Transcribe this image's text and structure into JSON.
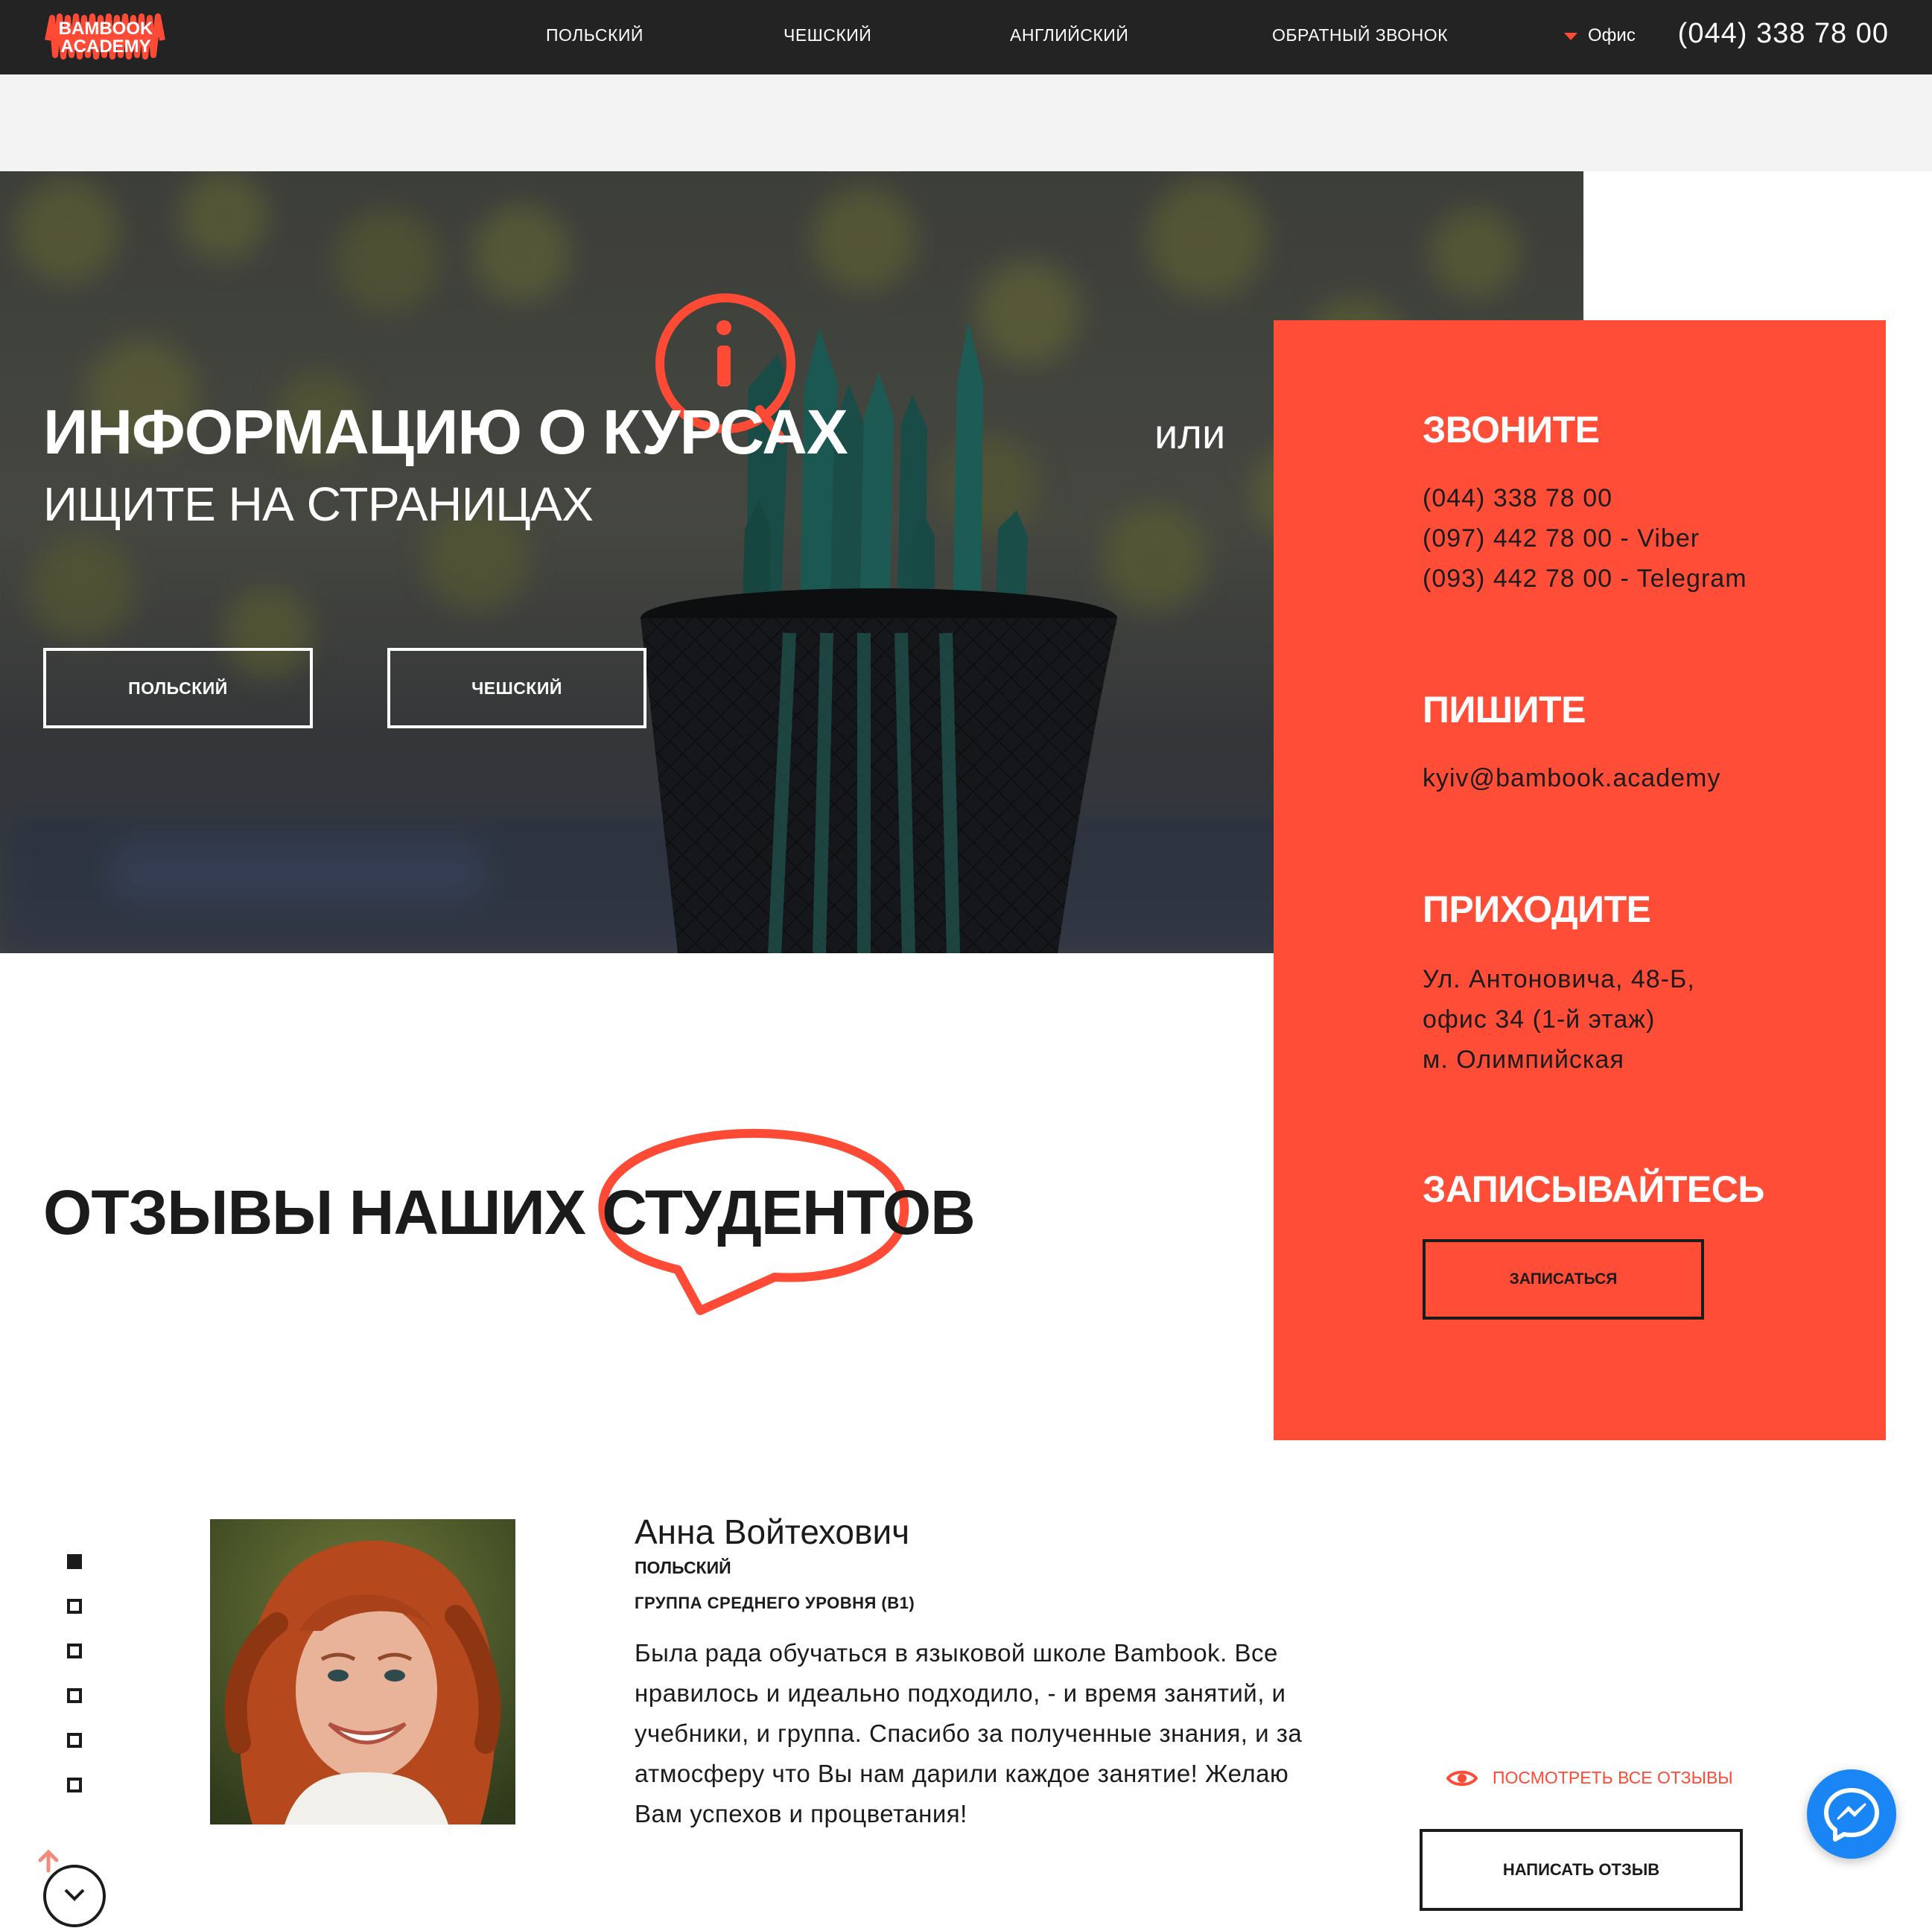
{
  "header": {
    "logo_line1": "BAMBOOK",
    "logo_line2": "ACADEMY",
    "nav": [
      "ПОЛЬСКИЙ",
      "ЧЕШСКИЙ",
      "АНГЛИЙСКИЙ",
      "ОБРАТНЫЙ ЗВОНОК"
    ],
    "office_label": "Офис",
    "phone": "(044) 338 78 00"
  },
  "hero": {
    "title": "ИНФОРМАЦИЮ О КУРСАХ",
    "subtitle": "ИЩИТЕ НА СТРАНИЦАХ",
    "or": "или",
    "buttons": [
      "ПОЛЬСКИЙ",
      "ЧЕШСКИЙ"
    ],
    "icon": "info-icon"
  },
  "contact": {
    "call_heading": "ЗВОНИТЕ",
    "phones": [
      "(044) 338 78 00",
      "(097) 442 78 00 - Viber",
      "(093) 442 78 00 - Telegram"
    ],
    "write_heading": "ПИШИТЕ",
    "email": "kyiv@bambook.academy",
    "visit_heading": "ПРИХОДИТЕ",
    "address": [
      "Ул. Антоновича, 48-Б,",
      "офис 34 (1-й этаж)",
      "м. Олимпийская"
    ],
    "signup_heading": "ЗАПИСЫВАЙТЕСЬ",
    "signup_button": "ЗАПИСАТЬСЯ",
    "accent_color": "#ff4d37"
  },
  "reviews": {
    "title": "ОТЗЫВЫ НАШИХ СТУДЕНТОВ",
    "slide_count": 6,
    "active_slide": 1,
    "current": {
      "name": "Анна Войтехович",
      "language": "ПОЛЬСКИЙ",
      "group": "ГРУППА СРЕДНЕГО УРОВНЯ (B1)",
      "text": "Была рада обучаться в языковой школе Bambook. Все нравилось и идеально подходило, - и время занятий, и учебники, и группа. Спасибо за полученные знания, и за атмосферу что Вы нам дарили каждое занятие! Желаю Вам успехов и процветания!"
    },
    "see_all": "ПОСМОТРЕТЬ ВСЕ ОТЗЫВЫ",
    "write_button": "НАПИСАТЬ ОТЗЫВ"
  },
  "icons": [
    "dropdown-triangle-icon",
    "info-icon",
    "speech-bubble-icon",
    "eye-icon",
    "messenger-icon",
    "arrow-up-icon",
    "chevron-down-icon"
  ]
}
